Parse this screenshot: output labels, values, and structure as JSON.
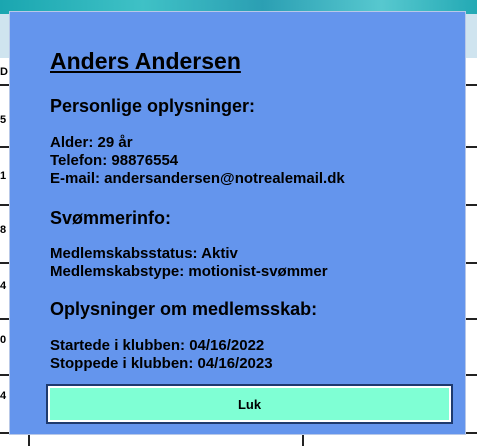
{
  "background": {
    "row_labels": [
      "D",
      "5",
      "1",
      "8",
      "4",
      "0",
      "4"
    ]
  },
  "modal": {
    "name": "Anders Andersen",
    "personal": {
      "heading": "Personlige oplysninger:",
      "age": "Alder: 29 år",
      "phone": "Telefon: 98876554",
      "email": "E-mail: andersandersen@notrealemail.dk"
    },
    "swimmer": {
      "heading": "Svømmerinfo:",
      "status": "Medlemskabsstatus: Aktiv",
      "type": "Medlemskabstype: motionist-svømmer"
    },
    "membership": {
      "heading": "Oplysninger om medlemsskab:",
      "started": "Startede i klubben: 04/16/2022",
      "stopped": "Stoppede i klubben: 04/16/2023"
    },
    "close_label": "Luk"
  },
  "colors": {
    "modal_bg": "#6495ed",
    "button_bg": "#7fffd4"
  }
}
